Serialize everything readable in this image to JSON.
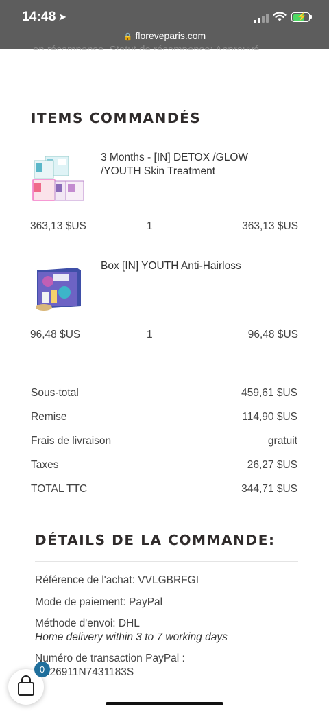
{
  "status": {
    "time": "14:48",
    "url": "floreveparis.com",
    "icons": [
      "location-arrow-icon",
      "cellular-signal-icon",
      "wifi-icon",
      "battery-charging-icon"
    ]
  },
  "cutoff_text": "en récompense. Statut de récompense: Approuvé",
  "items_section": {
    "title": "ITEMS COMMANDÉS",
    "items": [
      {
        "name": "3 Months - [IN] DETOX /GLOW /YOUTH Skin Treatment",
        "unit_price": "363,13 $US",
        "qty": "1",
        "total": "363,13 $US"
      },
      {
        "name": "Box [IN] YOUTH Anti-Hairloss",
        "unit_price": "96,48 $US",
        "qty": "1",
        "total": "96,48 $US"
      }
    ]
  },
  "summary": {
    "subtotal_label": "Sous-total",
    "subtotal": "459,61 $US",
    "discount_label": "Remise",
    "discount": "114,90 $US",
    "shipping_label": "Frais de livraison",
    "shipping": "gratuit",
    "taxes_label": "Taxes",
    "taxes": "26,27 $US",
    "total_label": "TOTAL TTC",
    "total": "344,71 $US"
  },
  "details": {
    "title": "DÉTAILS DE LA COMMANDE:",
    "reference": "Référence de l'achat: VVLGBRFGI",
    "payment": "Mode de paiement: PayPal",
    "shipping_method": "Méthode d'envoi: DHL",
    "shipping_note": "Home delivery within 3 to 7 working days",
    "transaction_label": "Numéro de transaction PayPal :",
    "transaction_id": "9M26911N7431183S"
  },
  "cart": {
    "count": "0"
  },
  "colors": {
    "status_bar": "#5d5d5d",
    "badge": "#1f6f9c",
    "battery": "#4cd964"
  }
}
